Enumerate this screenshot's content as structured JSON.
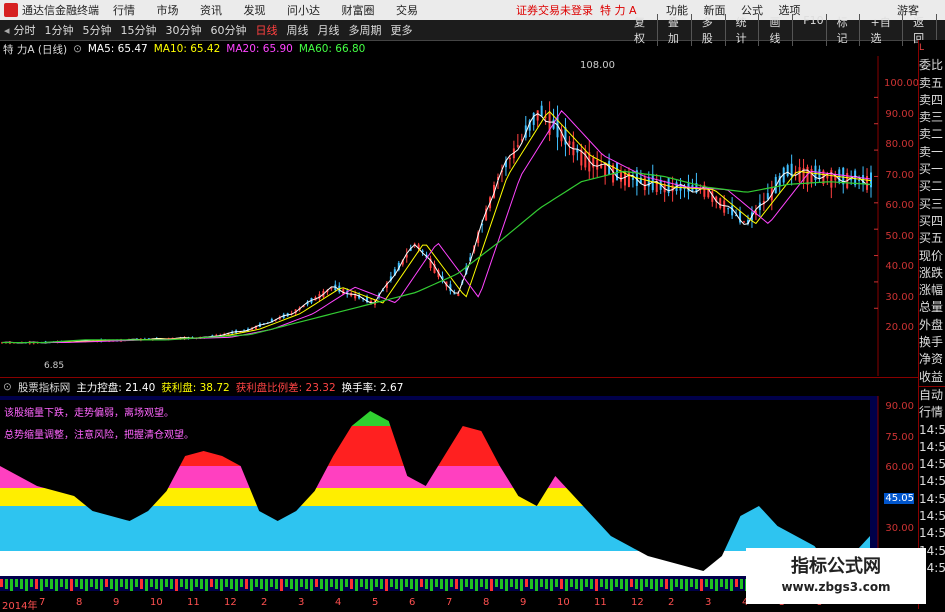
{
  "app": {
    "name": "通达信金融终端",
    "menu": [
      "行情",
      "市场",
      "资讯",
      "发现",
      "问小达",
      "财富圈",
      "交易"
    ],
    "notice": "证券交易未登录",
    "stock_title": "特 力 A",
    "right_menu": [
      "功能",
      "新面",
      "公式",
      "选项"
    ],
    "guest": "游客"
  },
  "periods": {
    "items": [
      "分时",
      "1分钟",
      "5分钟",
      "15分钟",
      "30分钟",
      "60分钟",
      "日线",
      "周线",
      "月线",
      "多周期",
      "更多"
    ],
    "active": "日线"
  },
  "tools": [
    "复权",
    "叠加",
    "多股",
    "统计",
    "画线",
    "F10",
    "标记",
    "+自选",
    "返回"
  ],
  "price_info": {
    "name": "特 力A (日线)",
    "ma5": "MA5: 65.47",
    "ma10": "MA10: 65.42",
    "ma20": "MA20: 65.90",
    "ma60": "MA60: 66.80",
    "colors": {
      "ma5": "#ffffff",
      "ma10": "#ffff00",
      "ma20": "#ff40ff",
      "ma60": "#40ff40"
    }
  },
  "indicator_info": {
    "site": "股票指标网",
    "zhuli": "主力控盘: 21.40",
    "huoli": "获利盘: 38.72",
    "bili": "获利盘比例差: 23.32",
    "huanshou": "换手率: 2.67"
  },
  "notes": {
    "line1": "该股缩量下跌，走势偏弱，离场观望。",
    "line2": "总势缩量调整，注意风险，把握清仓观望。"
  },
  "price_axis": [
    "100.00",
    "90.00",
    "80.00",
    "70.00",
    "60.00",
    "50.00",
    "40.00",
    "30.00",
    "20.00"
  ],
  "ind_axis": [
    "90.00",
    "75.00",
    "60.00",
    "45.00",
    "30.00"
  ],
  "marks": {
    "high": "108.00",
    "low": "6.85",
    "current_ind": "45.05"
  },
  "month_ticks": [
    "2014年",
    "7",
    "8",
    "9",
    "10",
    "11",
    "12",
    "2",
    "3",
    "4",
    "5",
    "6",
    "7",
    "8",
    "9",
    "10",
    "11",
    "12",
    "2",
    "3",
    "4",
    "5",
    "6"
  ],
  "right_panel": {
    "top": "L",
    "items": [
      "委比",
      "卖五",
      "卖四",
      "卖三",
      "卖二",
      "卖一",
      "买一",
      "买二",
      "买三",
      "买四",
      "买五",
      "现价",
      "涨跌",
      "涨幅",
      "总量",
      "外盘",
      "换手",
      "净资",
      "收益"
    ],
    "ind_items": [
      "自动",
      "行情",
      "14:5",
      "14:5",
      "14:5",
      "14:5",
      "14:5",
      "14:5",
      "14:5",
      "14:5",
      "14:5",
      "14:5"
    ]
  },
  "watermark": {
    "line1": "指标公式网",
    "line2": "www.zbgs3.com"
  },
  "chart_data": {
    "type": "line",
    "title": "特 力A (日线)",
    "ylim": [
      0,
      110
    ],
    "series": [
      {
        "name": "MA60",
        "values": [
          7,
          7,
          8,
          8,
          8,
          9,
          10,
          14,
          18,
          22,
          26,
          33,
          45,
          58,
          68,
          72,
          70,
          66,
          64,
          67,
          68,
          67
        ]
      }
    ],
    "x": [
      "2014年",
      "7",
      "8",
      "9",
      "10",
      "11",
      "12",
      "2",
      "3",
      "4",
      "5",
      "6",
      "7",
      "8",
      "9",
      "10",
      "11",
      "12",
      "2",
      "3",
      "4",
      "5"
    ]
  }
}
